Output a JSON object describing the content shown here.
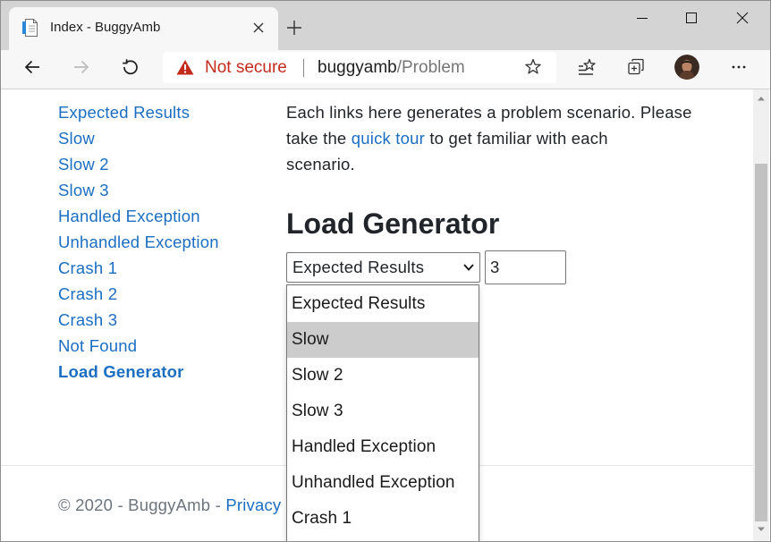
{
  "browser": {
    "tab_title": "Index - BuggyAmb",
    "security_label": "Not secure",
    "url_host": "buggyamb",
    "url_path": "/Problem",
    "forward_enabled": false
  },
  "icons": {
    "favicon": "page-icon",
    "tab_close": "close-icon",
    "new_tab": "plus-icon",
    "minimize": "minimize-icon",
    "maximize": "maximize-icon",
    "window_close": "close-icon",
    "back": "arrow-left-icon",
    "forward": "arrow-right-icon",
    "refresh": "refresh-icon",
    "security": "warning-triangle-icon",
    "favorite_page": "star-icon",
    "favorites": "favorites-icon",
    "collections": "collections-icon",
    "profile": "avatar",
    "more": "more-horizontal-icon",
    "select_chevron": "chevron-down-icon",
    "scroll_up": "triangle-up-icon",
    "scroll_down": "triangle-down-icon"
  },
  "nav": {
    "items": [
      {
        "label": "Expected Results"
      },
      {
        "label": "Slow"
      },
      {
        "label": "Slow 2"
      },
      {
        "label": "Slow 3"
      },
      {
        "label": "Handled Exception"
      },
      {
        "label": "Unhandled Exception"
      },
      {
        "label": "Crash 1"
      },
      {
        "label": "Crash 2"
      },
      {
        "label": "Crash 3"
      },
      {
        "label": "Not Found"
      },
      {
        "label": "Load Generator",
        "active": true
      }
    ]
  },
  "intro": {
    "line1": "Each links here generates a problem scenario. Please",
    "line2_start": "take the",
    "link": "quick tour",
    "line2_end": "to get familiar with each",
    "line3": "scenario."
  },
  "load_generator": {
    "heading": "Load Generator",
    "scenario_select": {
      "selected": "Expected Results",
      "expanded": true,
      "options": [
        {
          "label": "Expected Results"
        },
        {
          "label": "Slow",
          "highlighted": true
        },
        {
          "label": "Slow 2"
        },
        {
          "label": "Slow 3"
        },
        {
          "label": "Handled Exception"
        },
        {
          "label": "Unhandled Exception"
        },
        {
          "label": "Crash 1"
        }
      ]
    },
    "request_count": "3"
  },
  "footer": {
    "copyright": "© 2020 - BuggyAmb -",
    "privacy": "Privacy"
  },
  "colors": {
    "link": "#1b6ec2",
    "text": "#212529",
    "muted": "#6c757d",
    "warning": "#c42b1c",
    "highlight": "#cccccc"
  }
}
